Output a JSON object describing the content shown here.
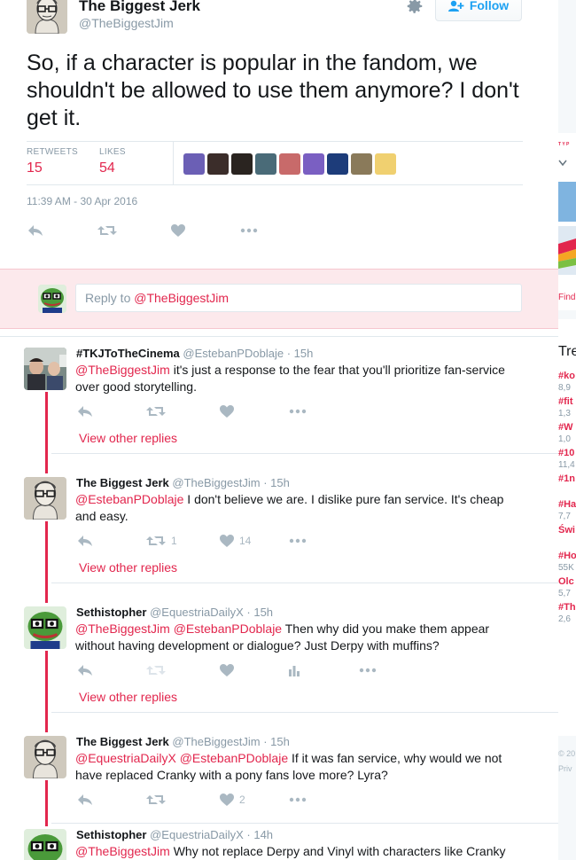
{
  "main_tweet": {
    "author_name": "The Biggest Jerk",
    "author_handle": "@TheBiggestJim",
    "follow_label": "Follow",
    "text": "So, if a character is popular in the fandom, we shouldn't be allowed to use them anymore? I don't get it.",
    "retweets_label": "RETWEETS",
    "retweets_count": "15",
    "likes_label": "LIKES",
    "likes_count": "54",
    "timestamp": "11:39 AM - 30 Apr 2016",
    "liker_colors": [
      "#6b5fb5",
      "#3b2d2a",
      "#2a2420",
      "#4a6b78",
      "#c86a6a",
      "#7a5fc2",
      "#1d3c7a",
      "#8a7a5a",
      "#f0d070"
    ]
  },
  "reply_box": {
    "prefix": "Reply to ",
    "mention": "@TheBiggestJim"
  },
  "replies": [
    {
      "name": "#TKJToTheCinema",
      "handle": "@EstebanPDoblaje",
      "time": "· 15h",
      "mention": "@TheBiggestJim",
      "text": " it's just a response to the fear that you'll prioritize fan-service over good storytelling.",
      "retweets": "",
      "likes": "",
      "view_other": "View other replies"
    },
    {
      "name": "The Biggest Jerk",
      "handle": "@TheBiggestJim",
      "time": "· 15h",
      "mention": "@EstebanPDoblaje",
      "text": " I don't believe we are. I dislike pure fan service. It's cheap and easy.",
      "retweets": "1",
      "likes": "14",
      "view_other": "View other replies"
    },
    {
      "name": "Sethistopher",
      "handle": "@EquestriaDailyX",
      "time": "· 15h",
      "mention": "@TheBiggestJim @EstebanPDoblaje",
      "text": " Then why did you make them appear without having development or dialogue? Just Derpy with muffins?",
      "retweets": "",
      "likes": "",
      "view_other": "View other replies"
    },
    {
      "name": "The Biggest Jerk",
      "handle": "@TheBiggestJim",
      "time": "· 15h",
      "mention": "@EquestriaDailyX @EstebanPDoblaje",
      "text": " If it was fan service, why would we not have replaced Cranky with a pony fans love more? Lyra?",
      "retweets": "",
      "likes": "2",
      "view_other": ""
    },
    {
      "name": "Sethistopher",
      "handle": "@EquestriaDailyX",
      "time": "· 14h",
      "mention": "@TheBiggestJim",
      "text": "  Why not replace Derpy and Vinyl with characters like Cranky",
      "retweets": "",
      "likes": "",
      "view_other": ""
    }
  ],
  "right_column": {
    "find_label": "Find",
    "trends_label": "Tre",
    "trend_items": [
      {
        "tag": "#ko",
        "count": "8,9"
      },
      {
        "tag": "#fit",
        "count": "1,3"
      },
      {
        "tag": "#W",
        "count": "1,0"
      },
      {
        "tag": "#10",
        "count": "11,4"
      },
      {
        "tag": "#1n",
        "count": ""
      },
      {
        "tag": "#Ha",
        "count": "7,7"
      },
      {
        "tag": "Świ",
        "count": ""
      },
      {
        "tag": "#Ho",
        "count": "55K"
      },
      {
        "tag": "Olc",
        "count": "5,7"
      },
      {
        "tag": "#Th",
        "count": "2,6"
      }
    ],
    "footer_year": "© 20",
    "footer_privacy": "Priv"
  },
  "colors": {
    "accent": "#e2264d",
    "muted": "#8899a6",
    "icon": "#aab8c2",
    "reply_bg": "#fce9ec"
  }
}
